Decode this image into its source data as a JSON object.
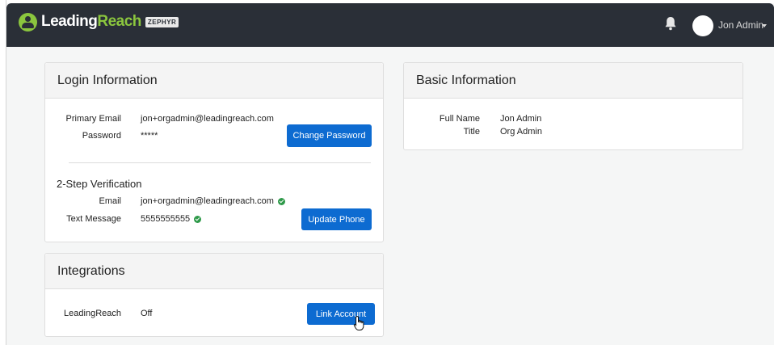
{
  "header": {
    "logo_leading": "Leading",
    "logo_reach": "Reach",
    "logo_badge": "ZEPHYR",
    "user_name": "Jon Admin",
    "icons": [
      "bell-icon",
      "avatar",
      "caret-down-icon"
    ]
  },
  "login": {
    "title": "Login Information",
    "primary_email_label": "Primary Email",
    "primary_email_value": "jon+orgadmin@leadingreach.com",
    "password_label": "Password",
    "password_value": "*****",
    "change_password_label": "Change Password",
    "two_step_title": "2-Step Verification",
    "email_label": "Email",
    "email_value": "jon+orgadmin@leadingreach.com",
    "text_label": "Text Message",
    "text_value": "5555555555",
    "update_phone_label": "Update Phone"
  },
  "integrations": {
    "title": "Integrations",
    "name": "LeadingReach",
    "status": "Off",
    "link_label": "Link Account"
  },
  "basic": {
    "title": "Basic Information",
    "full_name_label": "Full Name",
    "full_name_value": "Jon Admin",
    "title_label": "Title",
    "title_value": "Org Admin"
  },
  "colors": {
    "topbar": "#2a2f37",
    "brand_green": "#8bc63e",
    "button_blue": "#0d6bd1",
    "verified_green": "#2f9a4a"
  }
}
